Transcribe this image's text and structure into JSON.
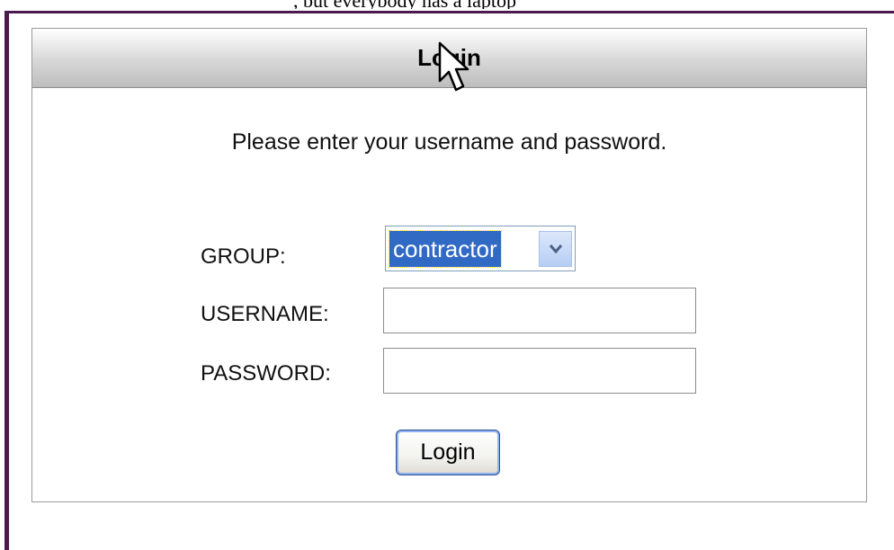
{
  "top_text": ", but everybody has a laptop",
  "panel": {
    "title": "Login"
  },
  "prompt": "Please enter your username and password.",
  "form": {
    "group_label": "GROUP:",
    "group_value": "contractor",
    "username_label": "USERNAME:",
    "username_value": "",
    "password_label": "PASSWORD:",
    "password_value": "",
    "submit_label": "Login"
  },
  "colors": {
    "frame": "#4a1a4e",
    "selection": "#316ac5",
    "button_border": "#2c4e8c"
  },
  "icons": {
    "cursor": "mouse-pointer-icon",
    "dropdown": "chevron-down-icon"
  }
}
